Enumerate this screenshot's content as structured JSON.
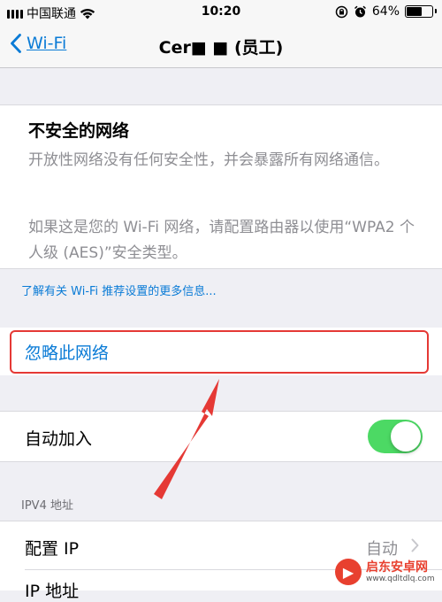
{
  "status_bar": {
    "carrier": "中国联通",
    "time": "10:20",
    "battery_percent": "64%",
    "battery_level": 0.64
  },
  "nav": {
    "back_label": "Wi-Fi",
    "title": "Cer■ ■ (员工)"
  },
  "security_info": {
    "title": "不安全的网络",
    "description": "开放性网络没有任何安全性，并会暴露所有网络通信。",
    "advice": "如果这是您的 Wi-Fi 网络，请配置路由器以使用“WPA2 个人级 (AES)”安全类型。"
  },
  "learn_more_link": "了解有关 Wi-Fi 推荐设置的更多信息...",
  "forget_network": "忽略此网络",
  "auto_join": {
    "label": "自动加入",
    "enabled": true
  },
  "ipv4_section": {
    "header": "IPV4 地址",
    "configure_ip_label": "配置 IP",
    "configure_ip_value": "自动",
    "ip_address_label": "IP 地址"
  },
  "watermark": {
    "name": "启东安卓网",
    "url": "www.qdltdlq.com"
  },
  "colors": {
    "ios_blue": "#0a7bd6",
    "toggle_green": "#4cd964",
    "annotation_red": "#e53935"
  }
}
